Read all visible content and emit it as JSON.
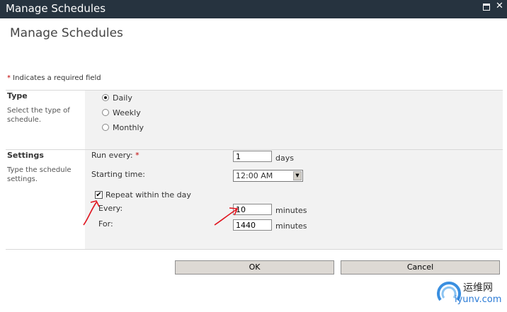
{
  "window": {
    "title": "Manage Schedules"
  },
  "page": {
    "heading": "Manage Schedules",
    "required_star": "*",
    "required_note": " Indicates a required field"
  },
  "type_section": {
    "title": "Type",
    "description": "Select the type of schedule.",
    "options": [
      {
        "label": "Daily",
        "selected": true
      },
      {
        "label": "Weekly",
        "selected": false
      },
      {
        "label": "Monthly",
        "selected": false
      }
    ]
  },
  "settings_section": {
    "title": "Settings",
    "description": "Type the schedule settings.",
    "run_every_label": "Run every: ",
    "run_every_star": "*",
    "run_every_value": "1",
    "run_every_unit": "days",
    "starting_time_label": "Starting time:",
    "starting_time_value": "12:00 AM",
    "repeat_label": "Repeat within the day",
    "repeat_checked": true,
    "every_label": "Every:",
    "every_value": "10",
    "every_unit": "minutes",
    "for_label": "For:",
    "for_value": "1440",
    "for_unit": "minutes"
  },
  "buttons": {
    "ok": "OK",
    "cancel": "Cancel"
  },
  "annotations": {
    "color": "#e0141e"
  },
  "watermark": {
    "text_cn": "运维网",
    "text_en": "iyunv.com"
  },
  "icons": {
    "maximize": "maximize-icon",
    "close": "close-icon",
    "dropdown": "chevron-down-icon"
  }
}
